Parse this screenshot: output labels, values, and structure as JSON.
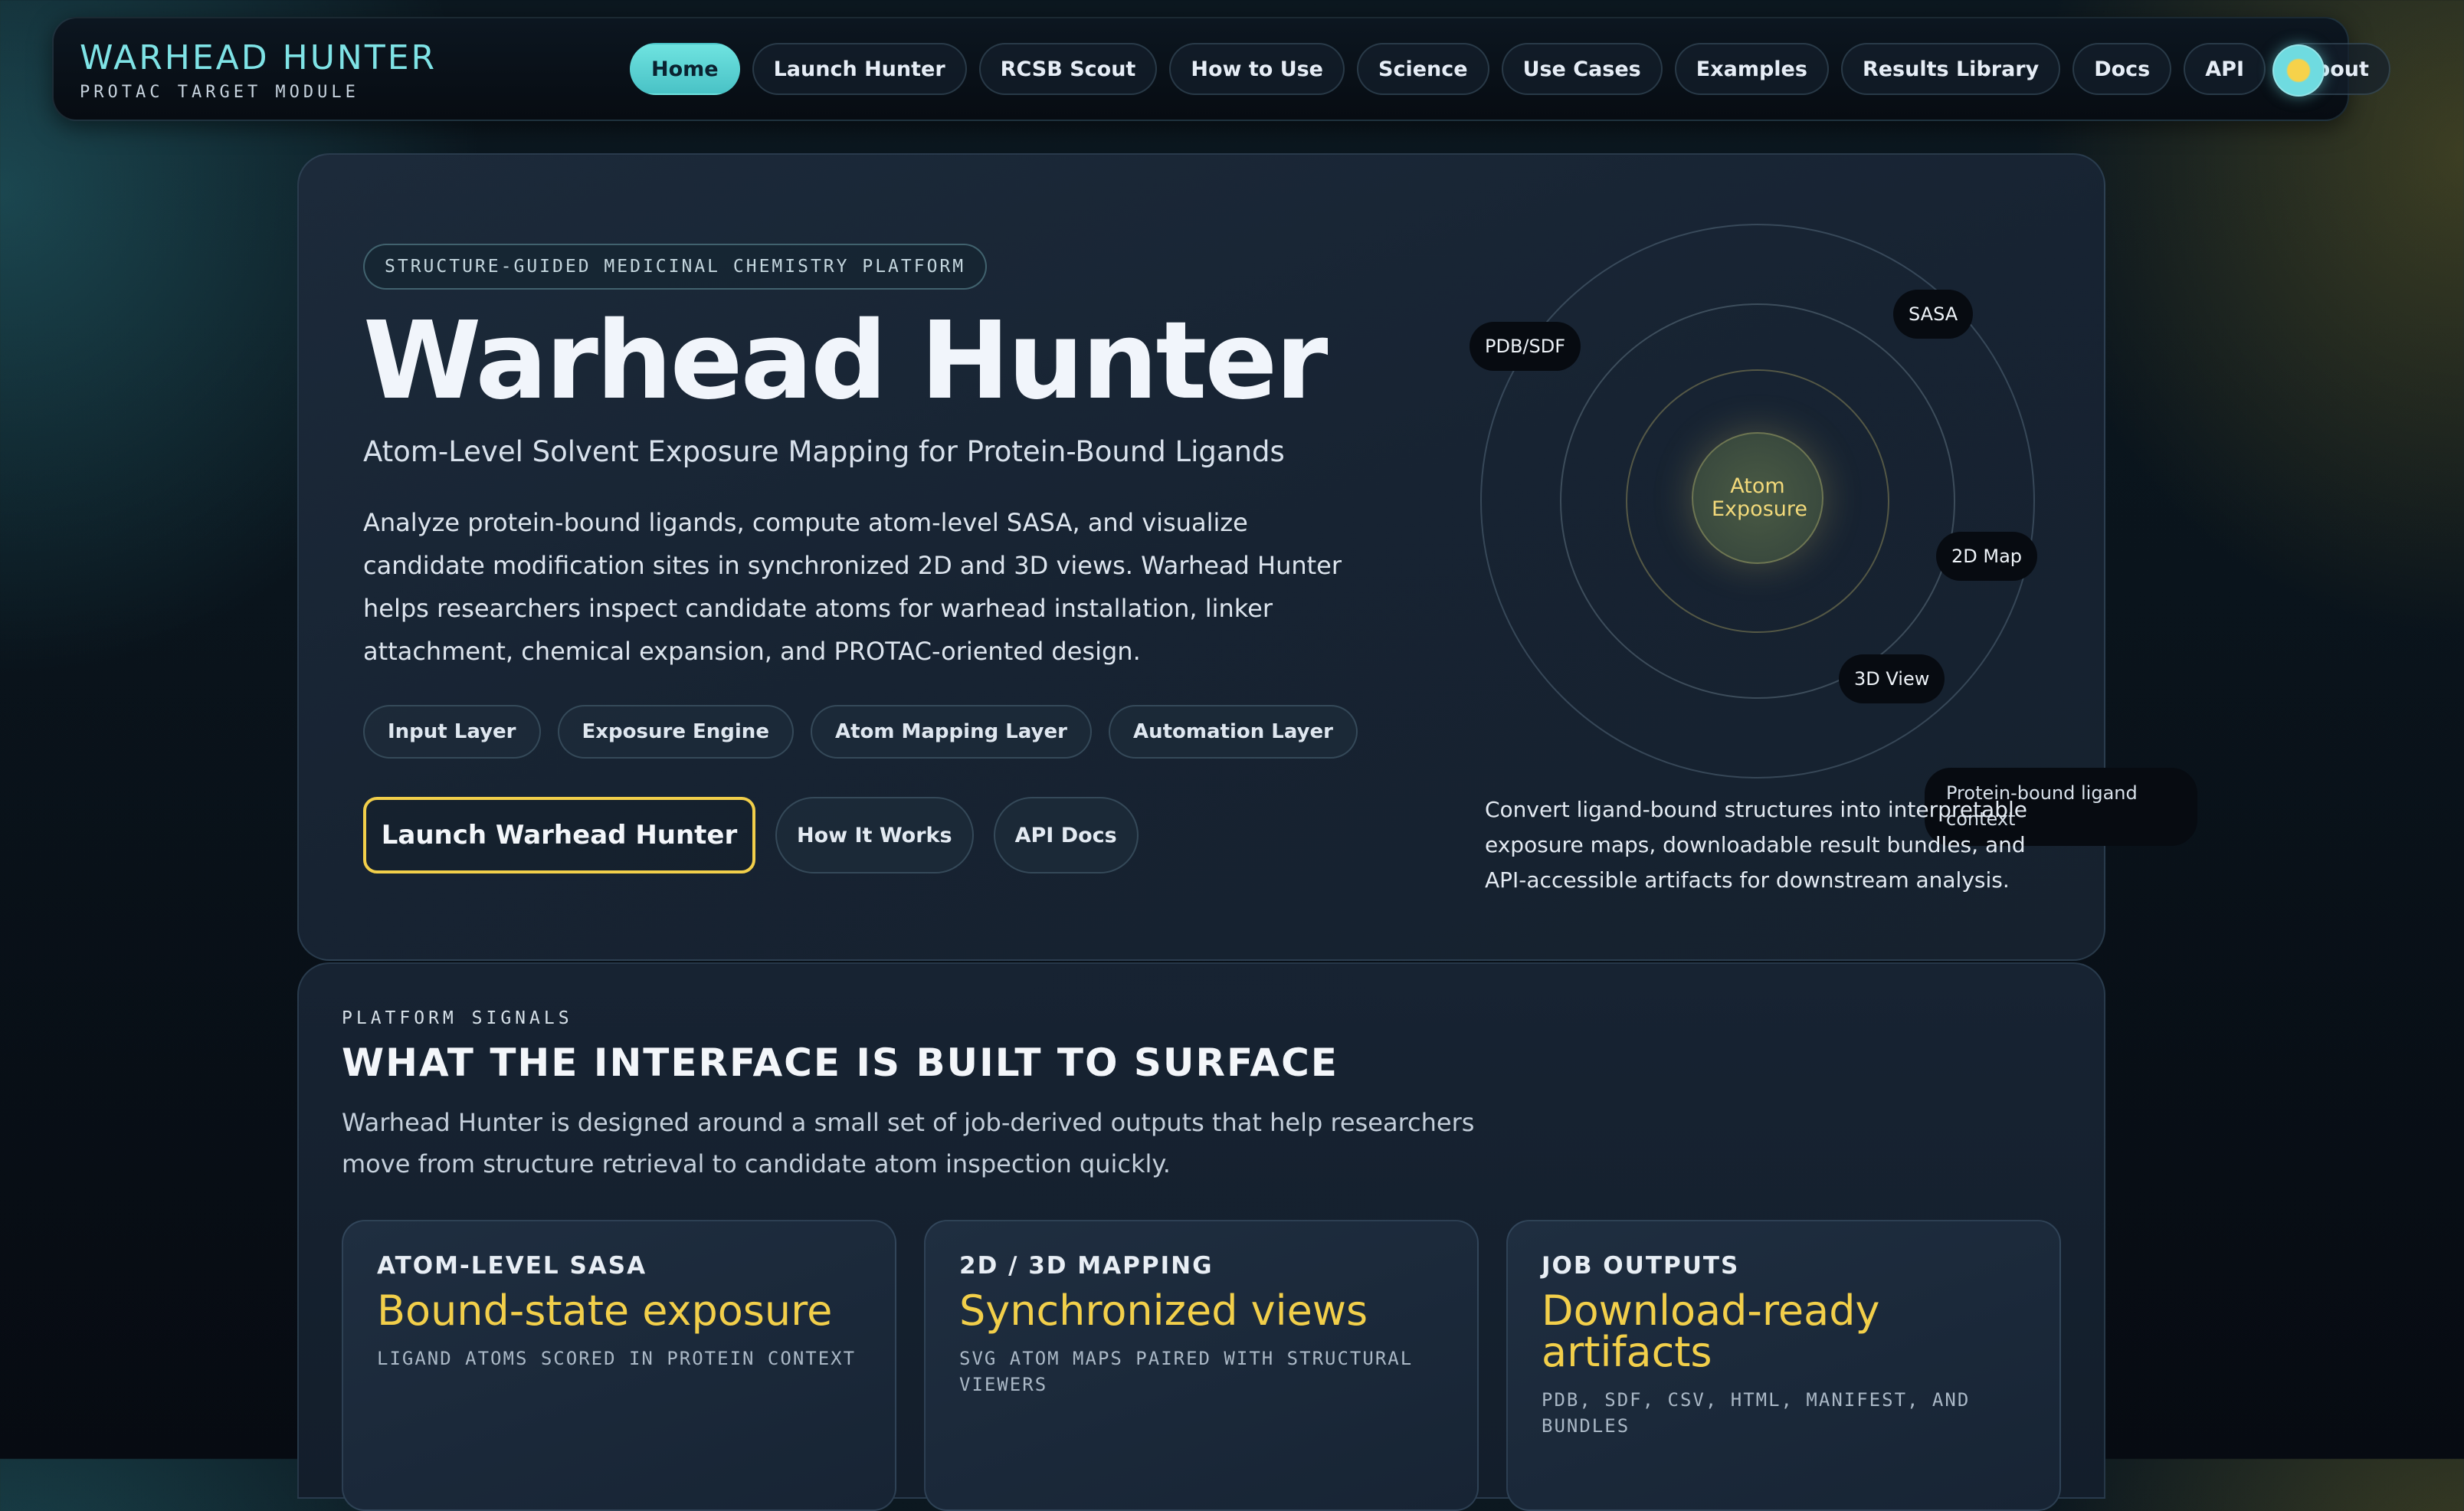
{
  "brand": {
    "title": "WARHEAD HUNTER",
    "subtitle": "PROTAC TARGET MODULE"
  },
  "nav": {
    "links": [
      "Home",
      "Launch Hunter",
      "RCSB Scout",
      "How to Use",
      "Science",
      "Use Cases",
      "Examples",
      "Results Library",
      "Docs",
      "API",
      "About"
    ],
    "active": "Home",
    "theme_icon": "sun-icon"
  },
  "hero": {
    "eyebrow": "STRUCTURE-GUIDED MEDICINAL CHEMISTRY PLATFORM",
    "title": "Warhead Hunter",
    "subtitle": "Atom-Level Solvent Exposure Mapping for Protein-Bound Ligands",
    "description": "Analyze protein-bound ligands, compute atom-level SASA, and visualize candidate modification sites in synchronized 2D and 3D views. Warhead Hunter helps researchers inspect candidate atoms for warhead installation, linker attachment, chemical expansion, and PROTAC-oriented design.",
    "layers": [
      "Input Layer",
      "Exposure Engine",
      "Atom Mapping Layer",
      "Automation Layer"
    ],
    "cta_primary": "Launch Warhead Hunter",
    "cta_secondary": [
      "How It Works",
      "API Docs"
    ],
    "orbit": {
      "core": "Atom Exposure",
      "tags": [
        "PDB/SDF",
        "SASA",
        "2D Map",
        "3D View"
      ],
      "context": "Protein-bound ligand context"
    },
    "side_text": "Convert ligand-bound structures into interpretable exposure maps, downloadable result bundles, and API-accessible artifacts for downstream analysis."
  },
  "signals": {
    "eyebrow": "PLATFORM SIGNALS",
    "title": "WHAT THE INTERFACE IS BUILT TO SURFACE",
    "description": "Warhead Hunter is designed around a small set of job-derived outputs that help researchers move from structure retrieval to candidate atom inspection quickly.",
    "cards": [
      {
        "label": "ATOM-LEVEL SASA",
        "value": "Bound-state exposure",
        "caption": "LIGAND ATOMS SCORED IN PROTEIN CONTEXT"
      },
      {
        "label": "2D / 3D MAPPING",
        "value": "Synchronized views",
        "caption": "SVG ATOM MAPS PAIRED WITH STRUCTURAL VIEWERS"
      },
      {
        "label": "JOB OUTPUTS",
        "value": "Download-ready artifacts",
        "caption": "PDB, SDF, CSV, HTML, MANIFEST, AND BUNDLES"
      }
    ]
  },
  "colors": {
    "accent": "#6fe3e0",
    "highlight": "#f2cf4a",
    "background": "#0a141c"
  }
}
